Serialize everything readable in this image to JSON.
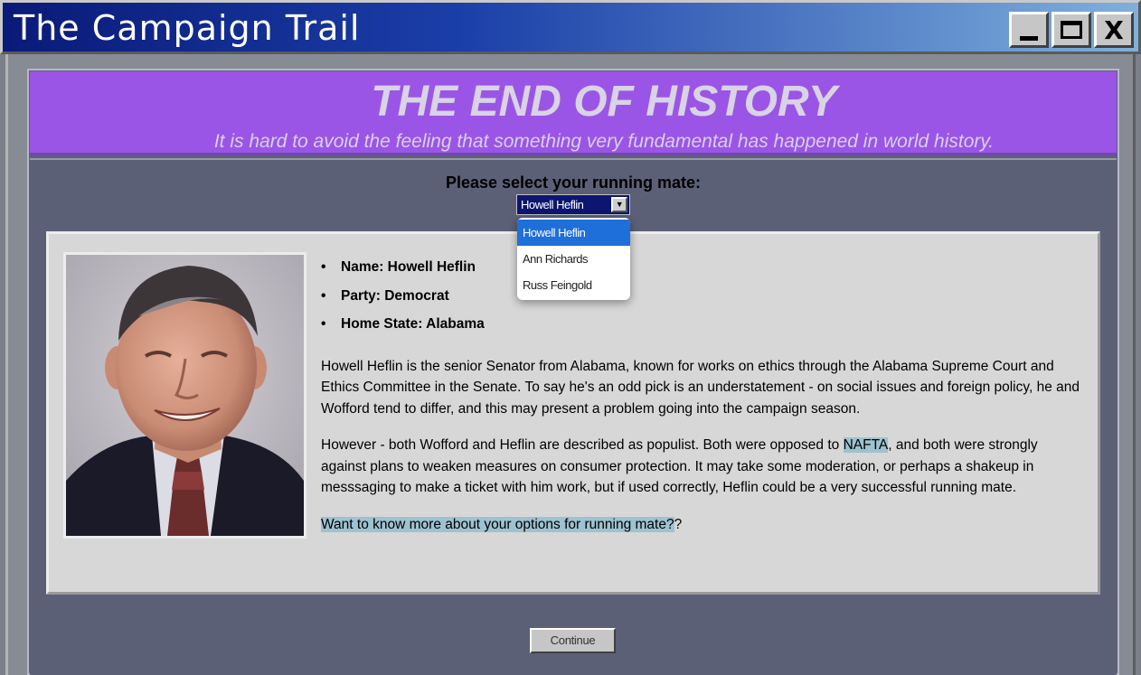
{
  "window": {
    "title": "The Campaign Trail",
    "minimize_icon": "minimize-icon",
    "maximize_icon": "maximize-icon",
    "close_icon": "close-icon",
    "close_glyph": "X"
  },
  "header": {
    "title": "THE END OF HISTORY",
    "subtitle": "It is hard to avoid the feeling that something very fundamental has happened in world history."
  },
  "running_mate": {
    "prompt": "Please select your running mate:",
    "selected": "Howell Heflin",
    "options": [
      "Howell Heflin",
      "Ann Richards",
      "Russ Feingold"
    ]
  },
  "candidate": {
    "name_line": "Name: Howell Heflin",
    "party_line": "Party: Democrat",
    "state_line": "Home State: Alabama",
    "paragraph1": "Howell Heflin is the senior Senator from Alabama, known for works on ethics through the Alabama Supreme Court and Ethics Committee in the Senate. To say he's an odd pick is an understatement - on social issues and foreign policy, he and Wofford tend to differ, and this may present a problem going into the campaign season.",
    "paragraph2_before": "However - both Wofford and Heflin are described as populist. Both were opposed to ",
    "paragraph2_link": "NAFTA",
    "paragraph2_after": ", and both were strongly against plans to weaken measures on consumer protection. It may take some moderation, or perhaps a shakeup in messsaging to make a ticket with him work, but if used correctly, Heflin could be a very successful running mate.",
    "more_link": "Want to know more about your options for running mate?",
    "more_suffix": "?"
  },
  "continue_label": "Continue"
}
